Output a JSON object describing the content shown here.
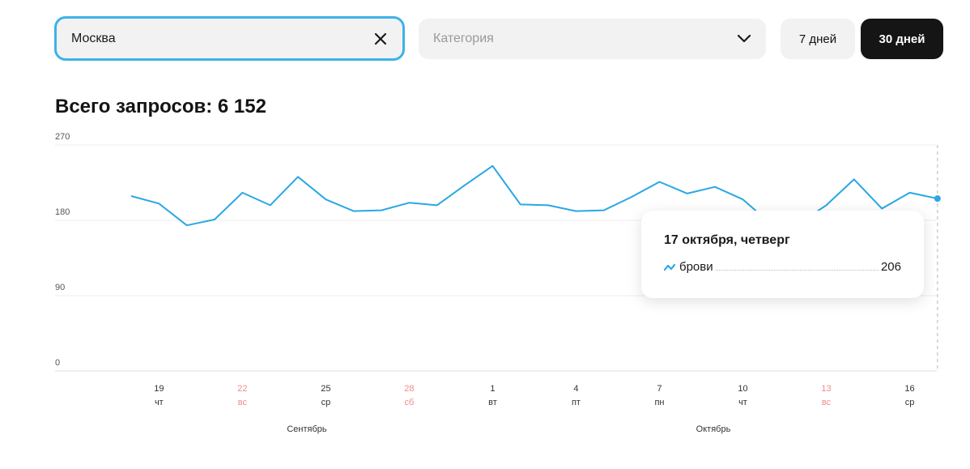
{
  "filters": {
    "city_value": "Москва",
    "category_placeholder": "Категория",
    "period_7": "7 дней",
    "period_30": "30 дней",
    "active_period": "30 дней"
  },
  "summary": {
    "total_label": "Всего запросов: 6 152"
  },
  "colors": {
    "line": "#2aa7e4",
    "weekend": "#f08a8a",
    "active_border": "#3db3e8"
  },
  "chart_data": {
    "type": "line",
    "title": "",
    "xlabel": "",
    "ylabel": "",
    "ylim": [
      0,
      270
    ],
    "y_ticks": [
      0,
      90,
      180,
      270
    ],
    "grid": true,
    "series": [
      {
        "name": "брови",
        "x": [
          "18 сентября",
          "19 сентября",
          "20 сентября",
          "21 сентября",
          "22 сентября",
          "23 сентября",
          "24 сентября",
          "25 сентября",
          "26 сентября",
          "27 сентября",
          "28 сентября",
          "29 сентября",
          "30 сентября",
          "1 октября",
          "2 октября",
          "3 октября",
          "4 октября",
          "5 октября",
          "6 октября",
          "7 октября",
          "8 октября",
          "9 октября",
          "10 октября",
          "11 октября",
          "12 октября",
          "13 октября",
          "14 октября",
          "15 октября",
          "16 октября",
          "17 октября"
        ],
        "values": [
          209,
          200,
          174,
          181,
          213,
          198,
          232,
          205,
          191,
          192,
          201,
          198,
          222,
          245,
          199,
          198,
          191,
          192,
          208,
          226,
          212,
          220,
          205,
          176,
          176,
          198,
          229,
          194,
          213,
          206
        ]
      }
    ],
    "x_ticks": [
      {
        "day": "19",
        "weekday": "чт",
        "weekend": false
      },
      {
        "day": "22",
        "weekday": "вс",
        "weekend": true
      },
      {
        "day": "25",
        "weekday": "ср",
        "weekend": false
      },
      {
        "day": "28",
        "weekday": "сб",
        "weekend": true
      },
      {
        "day": "1",
        "weekday": "вт",
        "weekend": false
      },
      {
        "day": "4",
        "weekday": "пт",
        "weekend": false
      },
      {
        "day": "7",
        "weekday": "пн",
        "weekend": false
      },
      {
        "day": "10",
        "weekday": "чт",
        "weekend": false
      },
      {
        "day": "13",
        "weekday": "вс",
        "weekend": true
      },
      {
        "day": "16",
        "weekday": "ср",
        "weekend": false
      }
    ],
    "months": [
      "Сентябрь",
      "Октябрь"
    ],
    "highlighted_index": 29
  },
  "tooltip": {
    "date": "17 октября, четверг",
    "series_label": "брови",
    "value": "206"
  }
}
